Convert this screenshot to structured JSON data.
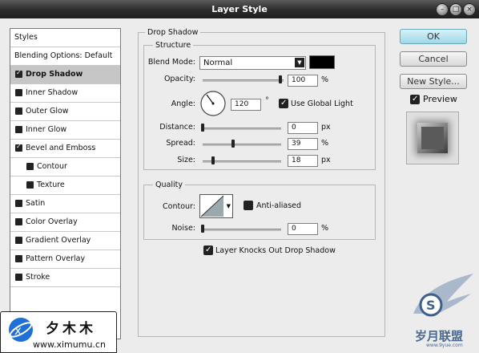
{
  "window": {
    "title": "Layer Style",
    "controls": [
      "–",
      "□",
      "×"
    ]
  },
  "styles_panel": {
    "header": "Styles",
    "blending": "Blending Options: Default",
    "items": [
      {
        "label": "Drop Shadow",
        "checked": true,
        "selected": true,
        "indent": false
      },
      {
        "label": "Inner Shadow",
        "checked": false,
        "selected": false,
        "indent": false
      },
      {
        "label": "Outer Glow",
        "checked": false,
        "selected": false,
        "indent": false
      },
      {
        "label": "Inner Glow",
        "checked": false,
        "selected": false,
        "indent": false
      },
      {
        "label": "Bevel and Emboss",
        "checked": true,
        "selected": false,
        "indent": false
      },
      {
        "label": "Contour",
        "checked": false,
        "selected": false,
        "indent": true
      },
      {
        "label": "Texture",
        "checked": false,
        "selected": false,
        "indent": true
      },
      {
        "label": "Satin",
        "checked": false,
        "selected": false,
        "indent": false
      },
      {
        "label": "Color Overlay",
        "checked": false,
        "selected": false,
        "indent": false
      },
      {
        "label": "Gradient Overlay",
        "checked": false,
        "selected": false,
        "indent": false
      },
      {
        "label": "Pattern Overlay",
        "checked": false,
        "selected": false,
        "indent": false
      },
      {
        "label": "Stroke",
        "checked": false,
        "selected": false,
        "indent": false
      }
    ]
  },
  "drop_shadow": {
    "title": "Drop Shadow",
    "structure": {
      "title": "Structure",
      "blend_mode_label": "Blend Mode:",
      "blend_mode_value": "Normal",
      "shadow_color": "#000000",
      "opacity_label": "Opacity:",
      "opacity_value": "100",
      "opacity_unit": "%",
      "angle_label": "Angle:",
      "angle_value": "120",
      "angle_unit": "°",
      "use_global_light_label": "Use Global Light",
      "use_global_light": true,
      "distance_label": "Distance:",
      "distance_value": "0",
      "distance_unit": "px",
      "spread_label": "Spread:",
      "spread_value": "39",
      "spread_unit": "%",
      "size_label": "Size:",
      "size_value": "18",
      "size_unit": "px"
    },
    "quality": {
      "title": "Quality",
      "contour_label": "Contour:",
      "anti_aliased_label": "Anti-aliased",
      "anti_aliased": false,
      "noise_label": "Noise:",
      "noise_value": "0",
      "noise_unit": "%"
    },
    "knockout_label": "Layer Knocks Out Drop Shadow",
    "knockout": true
  },
  "buttons": {
    "ok": "OK",
    "cancel": "Cancel",
    "new_style": "New Style...",
    "preview_label": "Preview",
    "preview": true
  },
  "watermark": {
    "left_text": "夕木木",
    "left_url": "www.ximumu.cn",
    "right_text": "岁月联盟",
    "right_url": "www.9yue.com"
  },
  "colors": {
    "title_bar": "#2b2b2b",
    "dialog_bg": "#ececec",
    "selected_row": "#c6c6c6",
    "ok_button": "#9fd8e6"
  }
}
